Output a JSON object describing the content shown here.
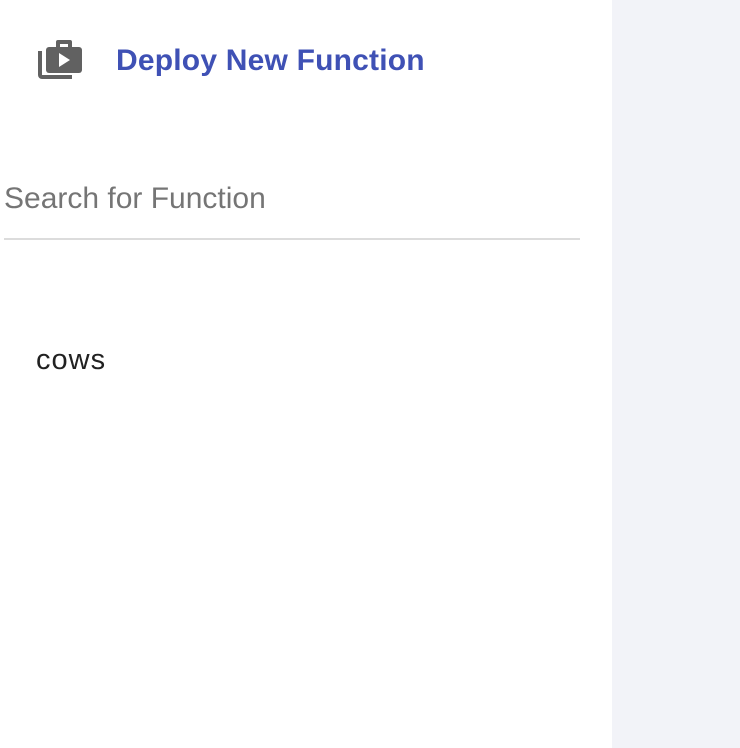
{
  "sidebar": {
    "deploy": {
      "label": "Deploy New Function",
      "icon": "play-briefcase-icon",
      "color": "#3f51b5",
      "icon_color": "#616161"
    },
    "search": {
      "placeholder": "Search for Function",
      "value": ""
    },
    "functions": [
      {
        "label": "cows"
      }
    ]
  },
  "colors": {
    "sidebar_bg": "#ffffff",
    "main_bg": "#f2f3f8",
    "accent": "#3f51b5"
  }
}
